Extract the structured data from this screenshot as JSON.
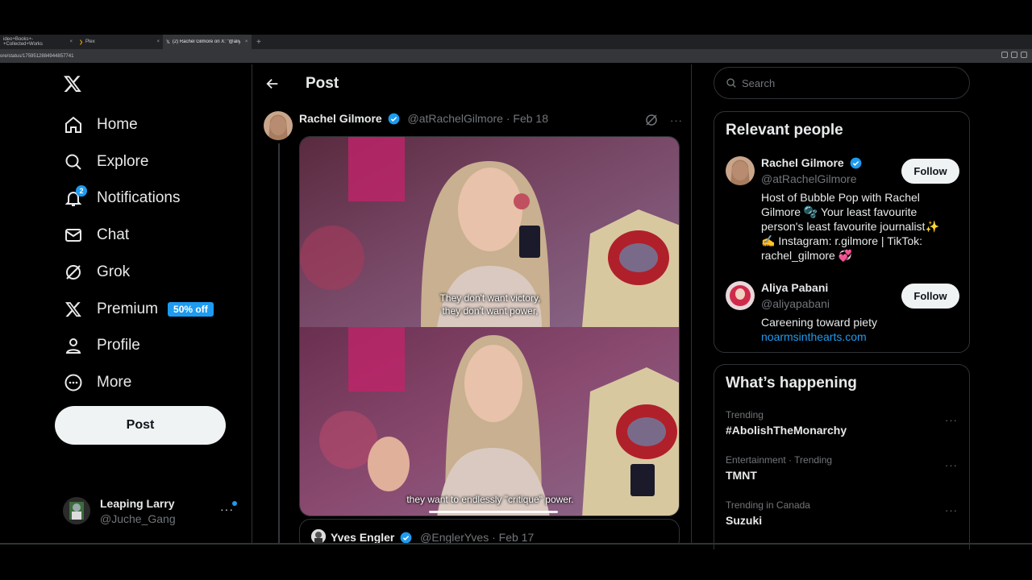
{
  "browser": {
    "tabs": [
      {
        "title": "ideo+Books+-+Collected+Works",
        "close": "×"
      },
      {
        "title": "Plex",
        "close": "×"
      },
      {
        "title": "(2) Rachel Gilmore on X: \"@aliyap",
        "close": "×"
      }
    ],
    "new_tab": "+",
    "url": "ore/status/1759512884944857741"
  },
  "nav": {
    "items": [
      {
        "label": "Home"
      },
      {
        "label": "Explore"
      },
      {
        "label": "Notifications",
        "badge": "2"
      },
      {
        "label": "Chat"
      },
      {
        "label": "Grok"
      },
      {
        "label": "Premium",
        "promo": "50% off"
      },
      {
        "label": "Profile"
      },
      {
        "label": "More"
      }
    ],
    "post_button": "Post"
  },
  "account": {
    "name": "Leaping Larry",
    "handle": "@Juche_Gang",
    "more": "···"
  },
  "main": {
    "title": "Post",
    "tweet": {
      "author": "Rachel Gilmore",
      "handle": "@atRachelGilmore · Feb 18",
      "more": "···",
      "caption_top": [
        "They don't want victory,",
        "they don't want power,"
      ],
      "caption_bottom": "they want to endlessly \"critique\" power."
    },
    "quote": {
      "author": "Yves Engler",
      "handle": "@EnglerYves · Feb 17"
    }
  },
  "search": {
    "placeholder": "Search"
  },
  "relevant": {
    "title": "Relevant people",
    "people": [
      {
        "name": "Rachel Gilmore",
        "handle": "@atRachelGilmore",
        "follow": "Follow",
        "bio": [
          "Host of Bubble Pop with Rachel",
          "Gilmore 🫧 Your least favourite",
          "person's least favourite journalist✨",
          "✍️ Instagram: r.gilmore | TikTok:",
          "rachel_gilmore 💞"
        ]
      },
      {
        "name": "Aliya Pabani",
        "handle": "@aliyapabani",
        "follow": "Follow",
        "bio": [
          "Careening toward piety"
        ],
        "link": "noarmsinthearts.com"
      }
    ]
  },
  "happening": {
    "title": "What’s happening",
    "trends": [
      {
        "meta": "Trending",
        "name": "#AbolishTheMonarchy",
        "more": "···"
      },
      {
        "meta": "Entertainment · Trending",
        "name": "TMNT",
        "more": "···"
      },
      {
        "meta": "Trending in Canada",
        "name": "Suzuki",
        "more": "···"
      }
    ]
  },
  "colors": {
    "accent": "#1d9bf0",
    "background": "#000000",
    "border": "#2f3336",
    "muted": "#71767b"
  }
}
